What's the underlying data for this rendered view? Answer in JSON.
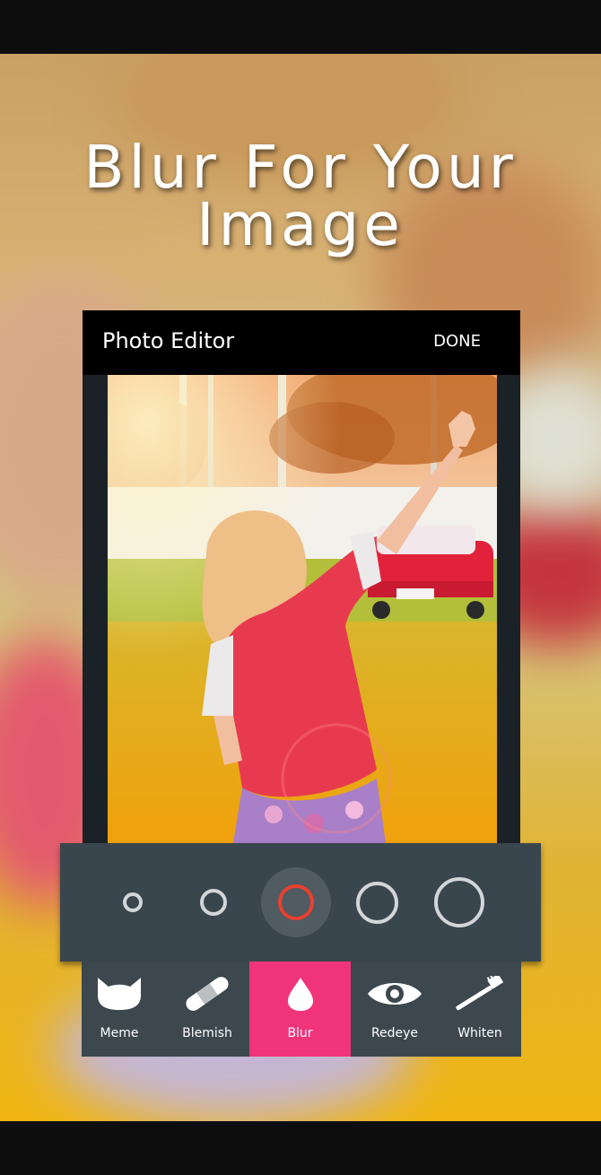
{
  "headline": {
    "line1": "Blur For Your",
    "line2": "Image"
  },
  "app_bar": {
    "title": "Photo Editor",
    "done_label": "DONE"
  },
  "brush_sizes": {
    "count": 5,
    "selected_index": 2,
    "accent": "#e8402f"
  },
  "tools": [
    {
      "label": "Meme",
      "icon": "cat-icon"
    },
    {
      "label": "Blemish",
      "icon": "bandage-icon"
    },
    {
      "label": "Blur",
      "icon": "drop-icon",
      "active": true
    },
    {
      "label": "Redeye",
      "icon": "eye-icon"
    },
    {
      "label": "Whiten",
      "icon": "toothbrush-icon"
    }
  ],
  "colors": {
    "active_tool": "#f0347a",
    "panel": "#3a464d",
    "toolbar": "#3c474e"
  }
}
